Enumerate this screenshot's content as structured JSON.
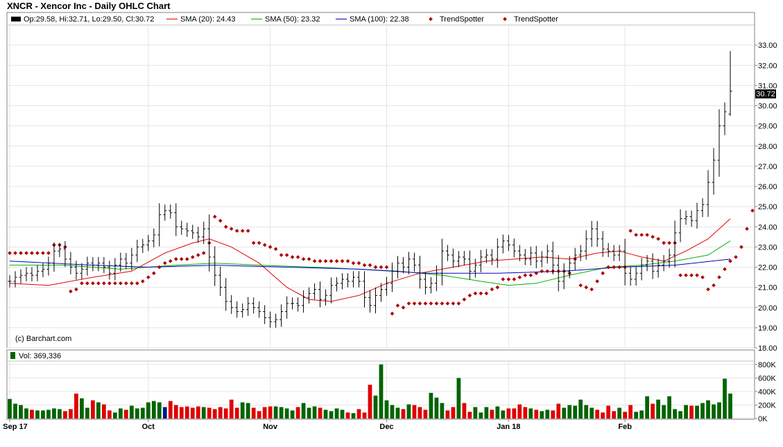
{
  "chart_title": "XNCR - Xencor Inc - Daily OHLC Chart",
  "legend": {
    "ohlc": "Op:29.58, Hi:32.71, Lo:29.50, Cl:30.72",
    "sma20": "SMA (20): 24.43",
    "sma50": "SMA (50): 23.32",
    "sma100": "SMA (100): 22.38",
    "trend1": "TrendSpotter",
    "trend2": "TrendSpotter",
    "volume": "Vol: 369,336"
  },
  "watermark": "(c) Barchart.com",
  "last_price_label": "30.72",
  "colors": {
    "sma20": "#e00000",
    "sma50": "#00b000",
    "sma100": "#0000c0",
    "trend": "#b00000",
    "vol_up": "#006400",
    "vol_down": "#e00000",
    "vol_selected": "#001a80"
  },
  "chart_data": {
    "type": "ohlc",
    "x_labels": [
      "Sep 17",
      "Oct",
      "Nov",
      "Dec",
      "Jan 18",
      "Feb"
    ],
    "x_label_index": [
      0,
      25,
      47,
      68,
      90,
      111
    ],
    "y_ticks": [
      "18.00",
      "19.00",
      "20.00",
      "21.00",
      "22.00",
      "23.00",
      "24.00",
      "25.00",
      "26.00",
      "27.00",
      "28.00",
      "29.00",
      "30.00",
      "31.00",
      "32.00",
      "33.00"
    ],
    "ylim": [
      18,
      34
    ],
    "vol_ticks": [
      "0K",
      "200K",
      "400K",
      "600K",
      "800K"
    ],
    "vol_ylim": [
      0,
      850000
    ],
    "close": [
      21.3,
      21.5,
      21.6,
      21.7,
      21.6,
      21.8,
      21.9,
      22.2,
      22.8,
      22.9,
      22.4,
      22.0,
      21.7,
      21.9,
      22.2,
      22.1,
      22.2,
      22.0,
      21.7,
      22.1,
      22.4,
      22.2,
      22.6,
      23.0,
      23.1,
      23.3,
      23.6,
      24.6,
      24.8,
      24.7,
      24.0,
      23.9,
      23.8,
      23.7,
      23.5,
      23.9,
      22.5,
      21.6,
      21.0,
      20.3,
      20.0,
      19.8,
      19.9,
      20.2,
      20.0,
      19.8,
      19.5,
      19.3,
      19.4,
      19.8,
      20.2,
      20.2,
      20.1,
      20.5,
      20.7,
      20.9,
      20.4,
      20.6,
      21.1,
      21.2,
      21.4,
      21.3,
      21.5,
      21.3,
      20.5,
      20.1,
      20.6,
      20.9,
      21.2,
      21.8,
      22.2,
      22.0,
      22.4,
      22.1,
      21.4,
      21.0,
      21.2,
      21.7,
      22.8,
      22.6,
      22.3,
      22.5,
      22.4,
      21.8,
      22.1,
      22.5,
      22.6,
      22.4,
      23.0,
      23.3,
      23.1,
      22.8,
      22.6,
      22.4,
      22.7,
      22.3,
      22.5,
      22.8,
      22.1,
      21.3,
      21.8,
      22.2,
      22.6,
      22.8,
      23.4,
      23.9,
      23.4,
      22.9,
      22.8,
      22.6,
      22.8,
      21.7,
      21.4,
      21.7,
      22.1,
      22.3,
      21.8,
      22.1,
      22.3,
      22.6,
      23.7,
      24.4,
      24.5,
      24.3,
      24.8,
      25.1,
      26.2,
      27.3,
      29.0,
      29.7,
      30.72
    ],
    "high_last": 32.71,
    "low_last": 29.5,
    "open_last": 29.58,
    "sma20": [
      {
        "i": 0,
        "v": 21.2
      },
      {
        "i": 7,
        "v": 21.1
      },
      {
        "i": 15,
        "v": 21.5
      },
      {
        "i": 22,
        "v": 21.8
      },
      {
        "i": 28,
        "v": 22.7
      },
      {
        "i": 33,
        "v": 23.2
      },
      {
        "i": 36,
        "v": 23.4
      },
      {
        "i": 40,
        "v": 23.0
      },
      {
        "i": 45,
        "v": 22.2
      },
      {
        "i": 50,
        "v": 21.0
      },
      {
        "i": 54,
        "v": 20.4
      },
      {
        "i": 58,
        "v": 20.3
      },
      {
        "i": 63,
        "v": 20.6
      },
      {
        "i": 68,
        "v": 21.2
      },
      {
        "i": 74,
        "v": 21.7
      },
      {
        "i": 80,
        "v": 22.0
      },
      {
        "i": 86,
        "v": 22.3
      },
      {
        "i": 91,
        "v": 22.4
      },
      {
        "i": 96,
        "v": 22.5
      },
      {
        "i": 101,
        "v": 22.4
      },
      {
        "i": 106,
        "v": 22.7
      },
      {
        "i": 110,
        "v": 22.8
      },
      {
        "i": 114,
        "v": 22.5
      },
      {
        "i": 118,
        "v": 22.3
      },
      {
        "i": 122,
        "v": 22.8
      },
      {
        "i": 126,
        "v": 23.4
      },
      {
        "i": 130,
        "v": 24.4
      }
    ],
    "sma50": [
      {
        "i": 0,
        "v": 22.1
      },
      {
        "i": 10,
        "v": 22.1
      },
      {
        "i": 20,
        "v": 21.9
      },
      {
        "i": 30,
        "v": 22.1
      },
      {
        "i": 37,
        "v": 22.2
      },
      {
        "i": 45,
        "v": 22.1
      },
      {
        "i": 55,
        "v": 22.0
      },
      {
        "i": 63,
        "v": 21.9
      },
      {
        "i": 70,
        "v": 21.8
      },
      {
        "i": 78,
        "v": 21.6
      },
      {
        "i": 85,
        "v": 21.3
      },
      {
        "i": 90,
        "v": 21.1
      },
      {
        "i": 95,
        "v": 21.2
      },
      {
        "i": 101,
        "v": 21.6
      },
      {
        "i": 108,
        "v": 22.0
      },
      {
        "i": 114,
        "v": 22.1
      },
      {
        "i": 120,
        "v": 22.3
      },
      {
        "i": 126,
        "v": 22.6
      },
      {
        "i": 130,
        "v": 23.3
      }
    ],
    "sma100": [
      {
        "i": 0,
        "v": 22.3
      },
      {
        "i": 15,
        "v": 22.1
      },
      {
        "i": 25,
        "v": 22.0
      },
      {
        "i": 37,
        "v": 22.1
      },
      {
        "i": 50,
        "v": 22.0
      },
      {
        "i": 63,
        "v": 21.9
      },
      {
        "i": 75,
        "v": 21.7
      },
      {
        "i": 88,
        "v": 21.7
      },
      {
        "i": 100,
        "v": 21.8
      },
      {
        "i": 110,
        "v": 22.0
      },
      {
        "i": 120,
        "v": 22.1
      },
      {
        "i": 130,
        "v": 22.4
      }
    ],
    "trendspotter": [
      22.7,
      22.7,
      22.7,
      22.7,
      22.7,
      22.7,
      22.7,
      22.7,
      23.1,
      23.1,
      23.0,
      20.8,
      20.9,
      21.2,
      21.2,
      21.2,
      21.2,
      21.2,
      21.2,
      21.2,
      21.2,
      21.2,
      21.2,
      21.2,
      21.3,
      21.5,
      21.7,
      22.0,
      22.2,
      22.3,
      22.4,
      22.4,
      22.4,
      22.5,
      22.6,
      22.7,
      23.2,
      24.5,
      24.3,
      24.0,
      23.9,
      23.8,
      23.8,
      23.8,
      23.2,
      23.2,
      23.1,
      23.0,
      22.9,
      22.6,
      22.6,
      22.5,
      22.5,
      22.4,
      22.4,
      22.3,
      22.3,
      22.3,
      22.3,
      22.3,
      22.3,
      22.3,
      22.2,
      22.2,
      22.1,
      22.1,
      22.0,
      22.0,
      22.0,
      19.7,
      20.1,
      20.0,
      20.2,
      20.2,
      20.2,
      20.2,
      20.2,
      20.2,
      20.2,
      20.2,
      20.2,
      20.2,
      20.4,
      20.6,
      20.7,
      20.7,
      20.7,
      20.9,
      21.0,
      21.4,
      21.4,
      21.4,
      21.5,
      21.6,
      21.6,
      21.7,
      21.8,
      21.8,
      21.8,
      21.8,
      21.8,
      21.7,
      22.4,
      21.1,
      21.0,
      20.9,
      21.3,
      21.7,
      22.0,
      22.0,
      22.0,
      22.0,
      23.8,
      23.6,
      23.6,
      23.6,
      23.5,
      23.4,
      23.2,
      23.2,
      23.2,
      21.6,
      21.6,
      21.6,
      21.6,
      21.5,
      20.9,
      21.1,
      21.5,
      21.9,
      22.3,
      22.5,
      23.0,
      23.9,
      24.8
    ],
    "volume": [
      290000,
      220000,
      200000,
      150000,
      130000,
      120000,
      120000,
      130000,
      150000,
      140000,
      110000,
      140000,
      370000,
      300000,
      160000,
      270000,
      240000,
      210000,
      120000,
      90000,
      150000,
      130000,
      190000,
      150000,
      160000,
      240000,
      260000,
      240000,
      170000,
      260000,
      200000,
      170000,
      180000,
      160000,
      180000,
      170000,
      160000,
      140000,
      170000,
      150000,
      280000,
      160000,
      240000,
      230000,
      160000,
      110000,
      170000,
      180000,
      180000,
      170000,
      150000,
      120000,
      170000,
      230000,
      160000,
      180000,
      160000,
      130000,
      110000,
      150000,
      130000,
      90000,
      80000,
      140000,
      90000,
      500000,
      340000,
      800000,
      270000,
      200000,
      160000,
      140000,
      210000,
      200000,
      170000,
      130000,
      380000,
      310000,
      230000,
      120000,
      170000,
      600000,
      230000,
      100000,
      170000,
      90000,
      170000,
      130000,
      180000,
      120000,
      150000,
      150000,
      210000,
      170000,
      150000,
      130000,
      110000,
      130000,
      120000,
      220000,
      160000,
      200000,
      190000,
      280000,
      200000,
      160000,
      130000,
      90000,
      190000,
      110000,
      160000,
      100000,
      200000,
      100000,
      120000,
      330000,
      220000,
      280000,
      200000,
      330000,
      140000,
      110000,
      200000,
      190000,
      190000,
      230000,
      270000,
      210000,
      240000,
      590000,
      370000
    ]
  }
}
